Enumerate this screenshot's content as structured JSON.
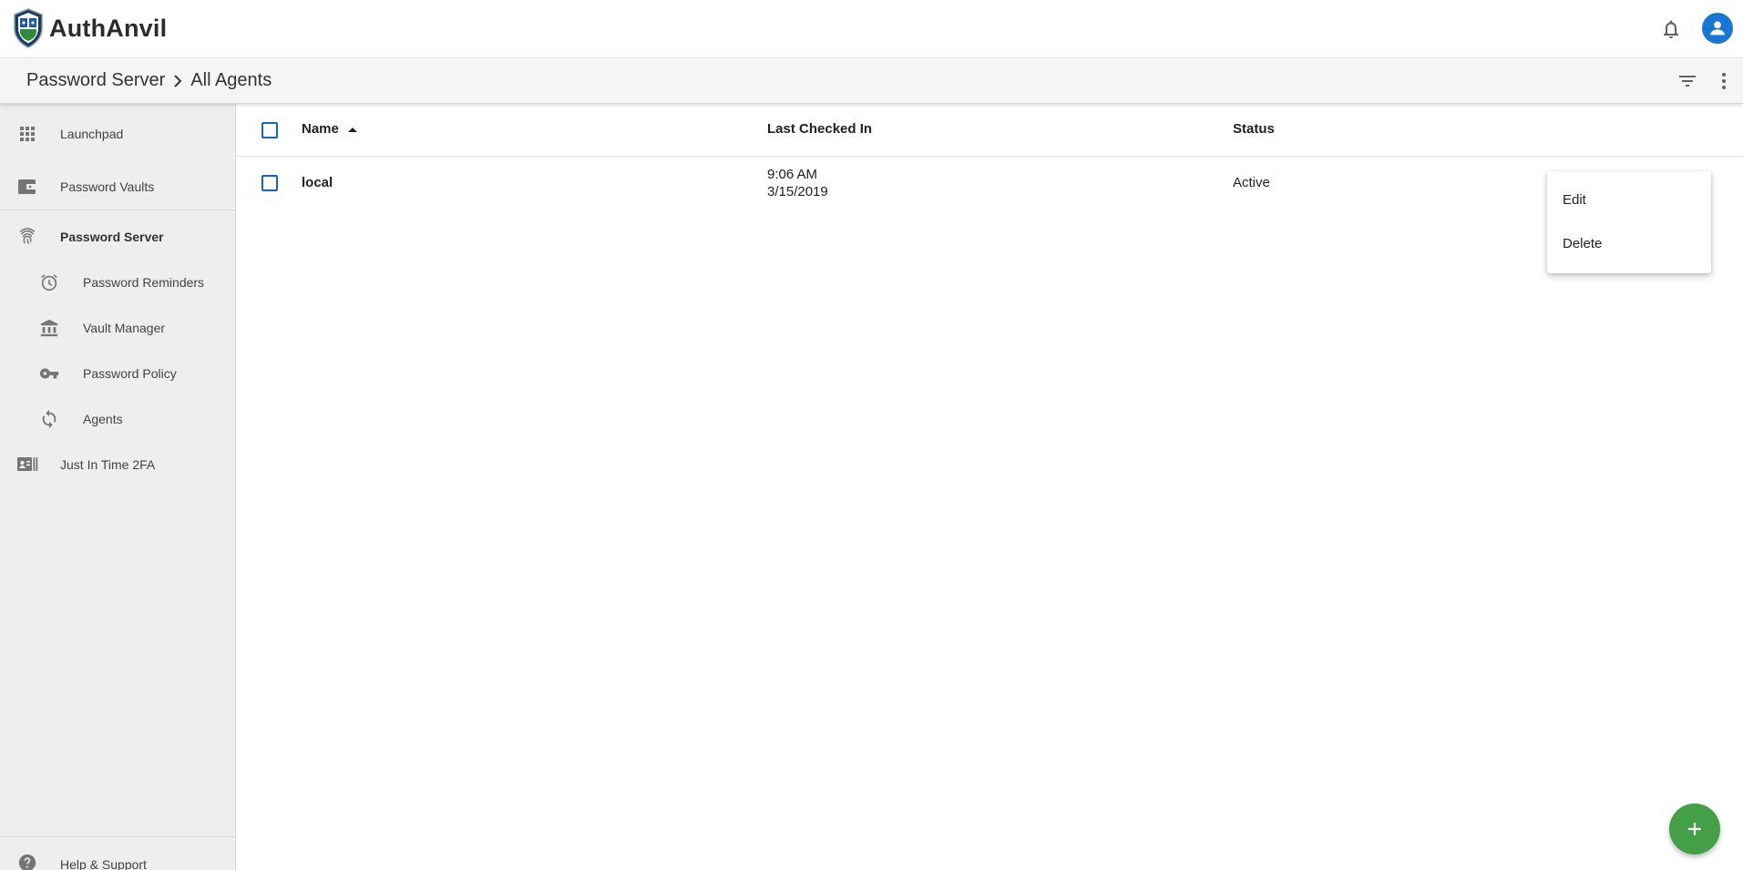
{
  "app": {
    "brand_name": "AuthAnvil",
    "accent_color": "#1976d2",
    "fab_color": "#43a047"
  },
  "breadcrumb": {
    "items": [
      "Password Server",
      "All Agents"
    ]
  },
  "sidebar": {
    "items": [
      {
        "label": "Launchpad",
        "icon": "apps-grid-icon"
      },
      {
        "label": "Password Vaults",
        "icon": "wallet-icon"
      },
      {
        "label": "Password Server",
        "icon": "fingerprint-icon",
        "active": true
      },
      {
        "label": "Password Reminders",
        "icon": "alarm-clock-icon"
      },
      {
        "label": "Vault Manager",
        "icon": "bank-icon"
      },
      {
        "label": "Password Policy",
        "icon": "key-icon"
      },
      {
        "label": "Agents",
        "icon": "sync-icon"
      },
      {
        "label": "Just In Time 2FA",
        "icon": "id-card-icon"
      }
    ],
    "help_label": "Help & Support"
  },
  "table": {
    "columns": [
      "Name",
      "Last Checked In",
      "Status"
    ],
    "sort": {
      "column": "Name",
      "direction": "ascending"
    },
    "rows": [
      {
        "name": "local",
        "time": "9:06 AM",
        "date": "3/15/2019",
        "status": "Active"
      }
    ]
  },
  "context_menu": {
    "items": [
      "Edit",
      "Delete"
    ]
  }
}
